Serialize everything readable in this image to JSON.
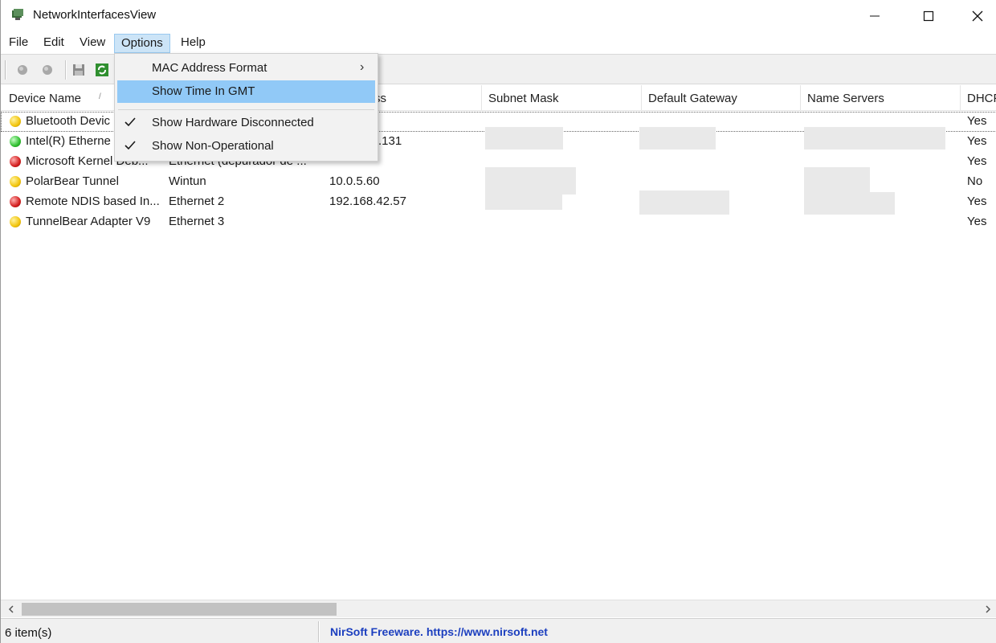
{
  "window": {
    "title": "NetworkInterfacesView"
  },
  "menubar": {
    "items": [
      {
        "label": "File"
      },
      {
        "label": "Edit"
      },
      {
        "label": "View"
      },
      {
        "label": "Options"
      },
      {
        "label": "Help"
      }
    ],
    "active": "Options"
  },
  "dropdown": {
    "items": [
      {
        "label": "MAC Address Format",
        "checked": false,
        "submenu": true,
        "highlighted": false
      },
      {
        "label": "Show Time In GMT",
        "checked": false,
        "submenu": false,
        "highlighted": true
      },
      {
        "label": "Show Hardware Disconnected",
        "checked": true,
        "submenu": false,
        "highlighted": false
      },
      {
        "label": "Show Non-Operational",
        "checked": true,
        "submenu": false,
        "highlighted": false
      }
    ],
    "submenu_arrow": "›"
  },
  "toolbar": {
    "icons": [
      "gray-circle-icon",
      "gray-circle-icon",
      "save-icon",
      "refresh-icon"
    ]
  },
  "table": {
    "columns": [
      "Device Name",
      "",
      "ss",
      "Subnet Mask",
      "Default Gateway",
      "Name Servers",
      "DHCP"
    ],
    "sort_indicator": "/",
    "rows": [
      {
        "status": "yellow",
        "device": "Bluetooth Devic",
        "conn": "",
        "ip": "",
        "dhcp": "Yes"
      },
      {
        "status": "green",
        "device": "Intel(R) Etherne",
        "conn": "",
        "ip": ".131",
        "dhcp": "Yes"
      },
      {
        "status": "red",
        "device": "Microsoft Kernel Deb...",
        "conn": "Ethernet (depurador de ...",
        "ip": "",
        "dhcp": "Yes"
      },
      {
        "status": "yellow",
        "device": "PolarBear Tunnel",
        "conn": "Wintun",
        "ip": "10.0.5.60",
        "dhcp": "No"
      },
      {
        "status": "red",
        "device": "Remote NDIS based In...",
        "conn": "Ethernet 2",
        "ip": "192.168.42.57",
        "dhcp": "Yes"
      },
      {
        "status": "yellow",
        "device": "TunnelBear Adapter V9",
        "conn": "Ethernet 3",
        "ip": "",
        "dhcp": "Yes"
      }
    ]
  },
  "status": {
    "count": "6 item(s)",
    "link": "NirSoft Freeware. https://www.nirsoft.net"
  },
  "colors": {
    "green": "#2fbf2f",
    "yellow": "#f2c40c",
    "red": "#d42020",
    "highlight": "#91c9f7",
    "link": "#1c3fbf"
  }
}
